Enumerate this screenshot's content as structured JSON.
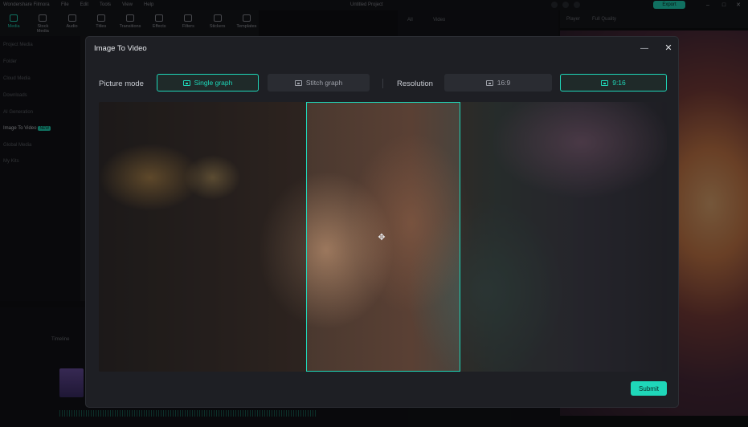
{
  "app": {
    "title": "Wondershare Filmora",
    "menu": [
      "File",
      "Edit",
      "Tools",
      "View",
      "Help"
    ],
    "project": "Untitled Project",
    "export_label": "Export",
    "toolbar": [
      "Media",
      "Stock Media",
      "Audio",
      "Titles",
      "Transitions",
      "Effects",
      "Filters",
      "Stickers",
      "Templates"
    ],
    "left_panel": [
      "Project Media",
      "Folder",
      "Cloud Media",
      "Downloads",
      "AI Generation",
      "Image To Video",
      "Global Media",
      "My Kits"
    ],
    "left_panel_new_badge": "NEW",
    "media_tabs": [
      "All",
      "Video"
    ],
    "player_label": "Player",
    "player_quality": "Full Quality",
    "timeline_label": "Timeline"
  },
  "dialog": {
    "title": "Image To Video",
    "picture_mode_label": "Picture mode",
    "modes": [
      {
        "label": "Single graph",
        "selected": true
      },
      {
        "label": "Stitch graph",
        "selected": false
      }
    ],
    "resolution_label": "Resolution",
    "resolutions": [
      {
        "label": "16:9",
        "selected": false
      },
      {
        "label": "9:16",
        "selected": true
      }
    ],
    "submit_label": "Submit"
  },
  "colors": {
    "accent": "#1fd7b9",
    "dialog_bg": "#1e1f24",
    "option_bg": "#2a2c32"
  },
  "icons": {
    "minimize": "minimize-icon",
    "close": "close-icon",
    "move": "move-icon",
    "mode": "image-icon",
    "resolution": "screen-icon"
  }
}
